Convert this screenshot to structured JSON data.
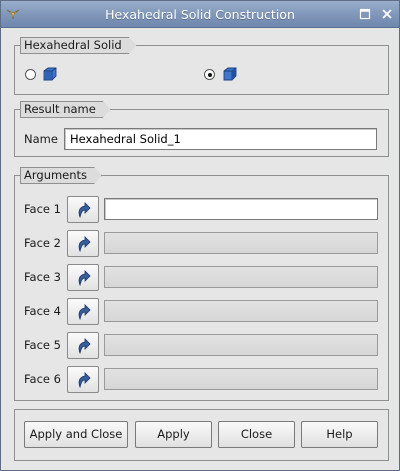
{
  "window": {
    "title": "Hexahedral Solid Construction"
  },
  "construction_group": {
    "label": "Hexahedral Solid",
    "options": [
      {
        "name": "by-vertices",
        "icon": "hexahedron-vertices-icon",
        "selected": false
      },
      {
        "name": "by-faces",
        "icon": "hexahedron-faces-icon",
        "selected": true
      }
    ]
  },
  "result_group": {
    "label": "Result name",
    "name_label": "Name",
    "name_value": "Hexahedral Solid_1"
  },
  "arguments_group": {
    "label": "Arguments",
    "faces": [
      {
        "label": "Face 1",
        "value": "",
        "enabled": true
      },
      {
        "label": "Face 2",
        "value": "",
        "enabled": false
      },
      {
        "label": "Face 3",
        "value": "",
        "enabled": false
      },
      {
        "label": "Face 4",
        "value": "",
        "enabled": false
      },
      {
        "label": "Face 5",
        "value": "",
        "enabled": false
      },
      {
        "label": "Face 6",
        "value": "",
        "enabled": false
      }
    ]
  },
  "buttons": {
    "apply_and_close": "Apply and Close",
    "apply": "Apply",
    "close": "Close",
    "help": "Help"
  },
  "colors": {
    "titlebar": "#7f96b8",
    "cube_blue": "#2f63b8"
  }
}
